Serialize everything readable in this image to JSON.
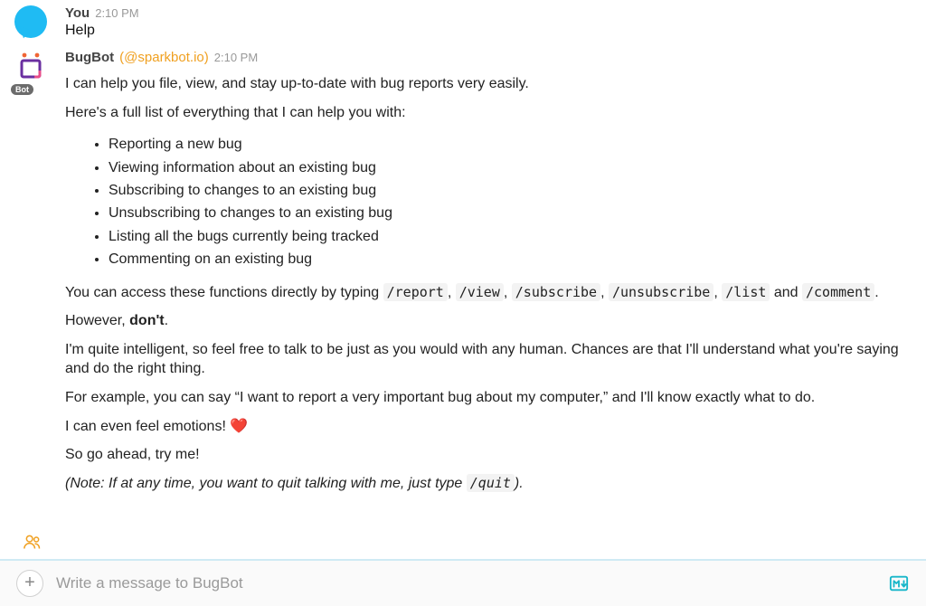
{
  "messages": [
    {
      "sender": "You",
      "timestamp": "2:10 PM",
      "text": "Help"
    },
    {
      "sender": "BugBot",
      "handle": "(@sparkbot.io)",
      "timestamp": "2:10 PM",
      "bot_badge": "Bot",
      "p1": "I can help you file, view, and stay up-to-date with bug reports very easily.",
      "p2": "Here's a full list of everything that I can help you with:",
      "bullets": [
        "Reporting a new bug",
        "Viewing information about an existing bug",
        "Subscribing to changes to an existing bug",
        "Unsubscribing to changes to an existing bug",
        "Listing all the bugs currently being tracked",
        "Commenting on an existing bug"
      ],
      "p3_pre": "You can access these functions directly by typing ",
      "cmds": [
        "/report",
        "/view",
        "/subscribe",
        "/unsubscribe",
        "/list",
        "/comment"
      ],
      "sep_comma": ", ",
      "sep_and": " and ",
      "p3_post": ".",
      "p4_pre": "However, ",
      "p4_bold": "don't",
      "p4_post": ".",
      "p5": "I'm quite intelligent, so feel free to talk to be just as you would with any human. Chances are that I'll understand what you're saying and do the right thing.",
      "p6": "For example, you can say “I want to report a very important bug about my computer,” and I'll know exactly what to do.",
      "p7_pre": "I can even feel emotions! ",
      "p7_heart": "❤️",
      "p8": "So go ahead, try me!",
      "p9_pre": "(Note: If at any time, you want to quit talking with me, just type ",
      "p9_cmd": "/quit",
      "p9_post": ")."
    }
  ],
  "composer": {
    "placeholder": "Write a message to BugBot"
  }
}
